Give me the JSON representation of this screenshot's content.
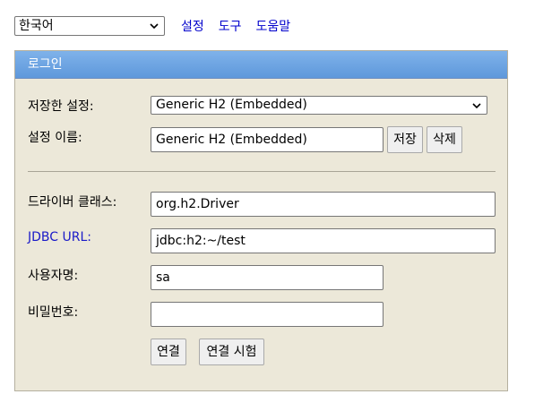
{
  "topbar": {
    "language_value": "한국어",
    "links": [
      "설정",
      "도구",
      "도움말"
    ]
  },
  "panel": {
    "title": "로그인",
    "saved_settings_label": "저장한 설정:",
    "saved_settings_value": "Generic H2 (Embedded)",
    "setting_name_label": "설정 이름:",
    "setting_name_value": "Generic H2 (Embedded)",
    "save_button": "저장",
    "delete_button": "삭제",
    "driver_class_label": "드라이버 클래스:",
    "driver_class_value": "org.h2.Driver",
    "jdbc_url_label": "JDBC URL:",
    "jdbc_url_value": "jdbc:h2:~/test",
    "username_label": "사용자명:",
    "username_value": "sa",
    "password_label": "비밀번호:",
    "password_value": "",
    "connect_button": "연결",
    "test_connection_button": "연결 시험"
  },
  "colors": {
    "header_blue": "#6aa3e3",
    "panel_bg": "#ece8d9",
    "link_blue": "#0000cc"
  },
  "icons": {
    "dropdown": "chevron-down-icon"
  }
}
